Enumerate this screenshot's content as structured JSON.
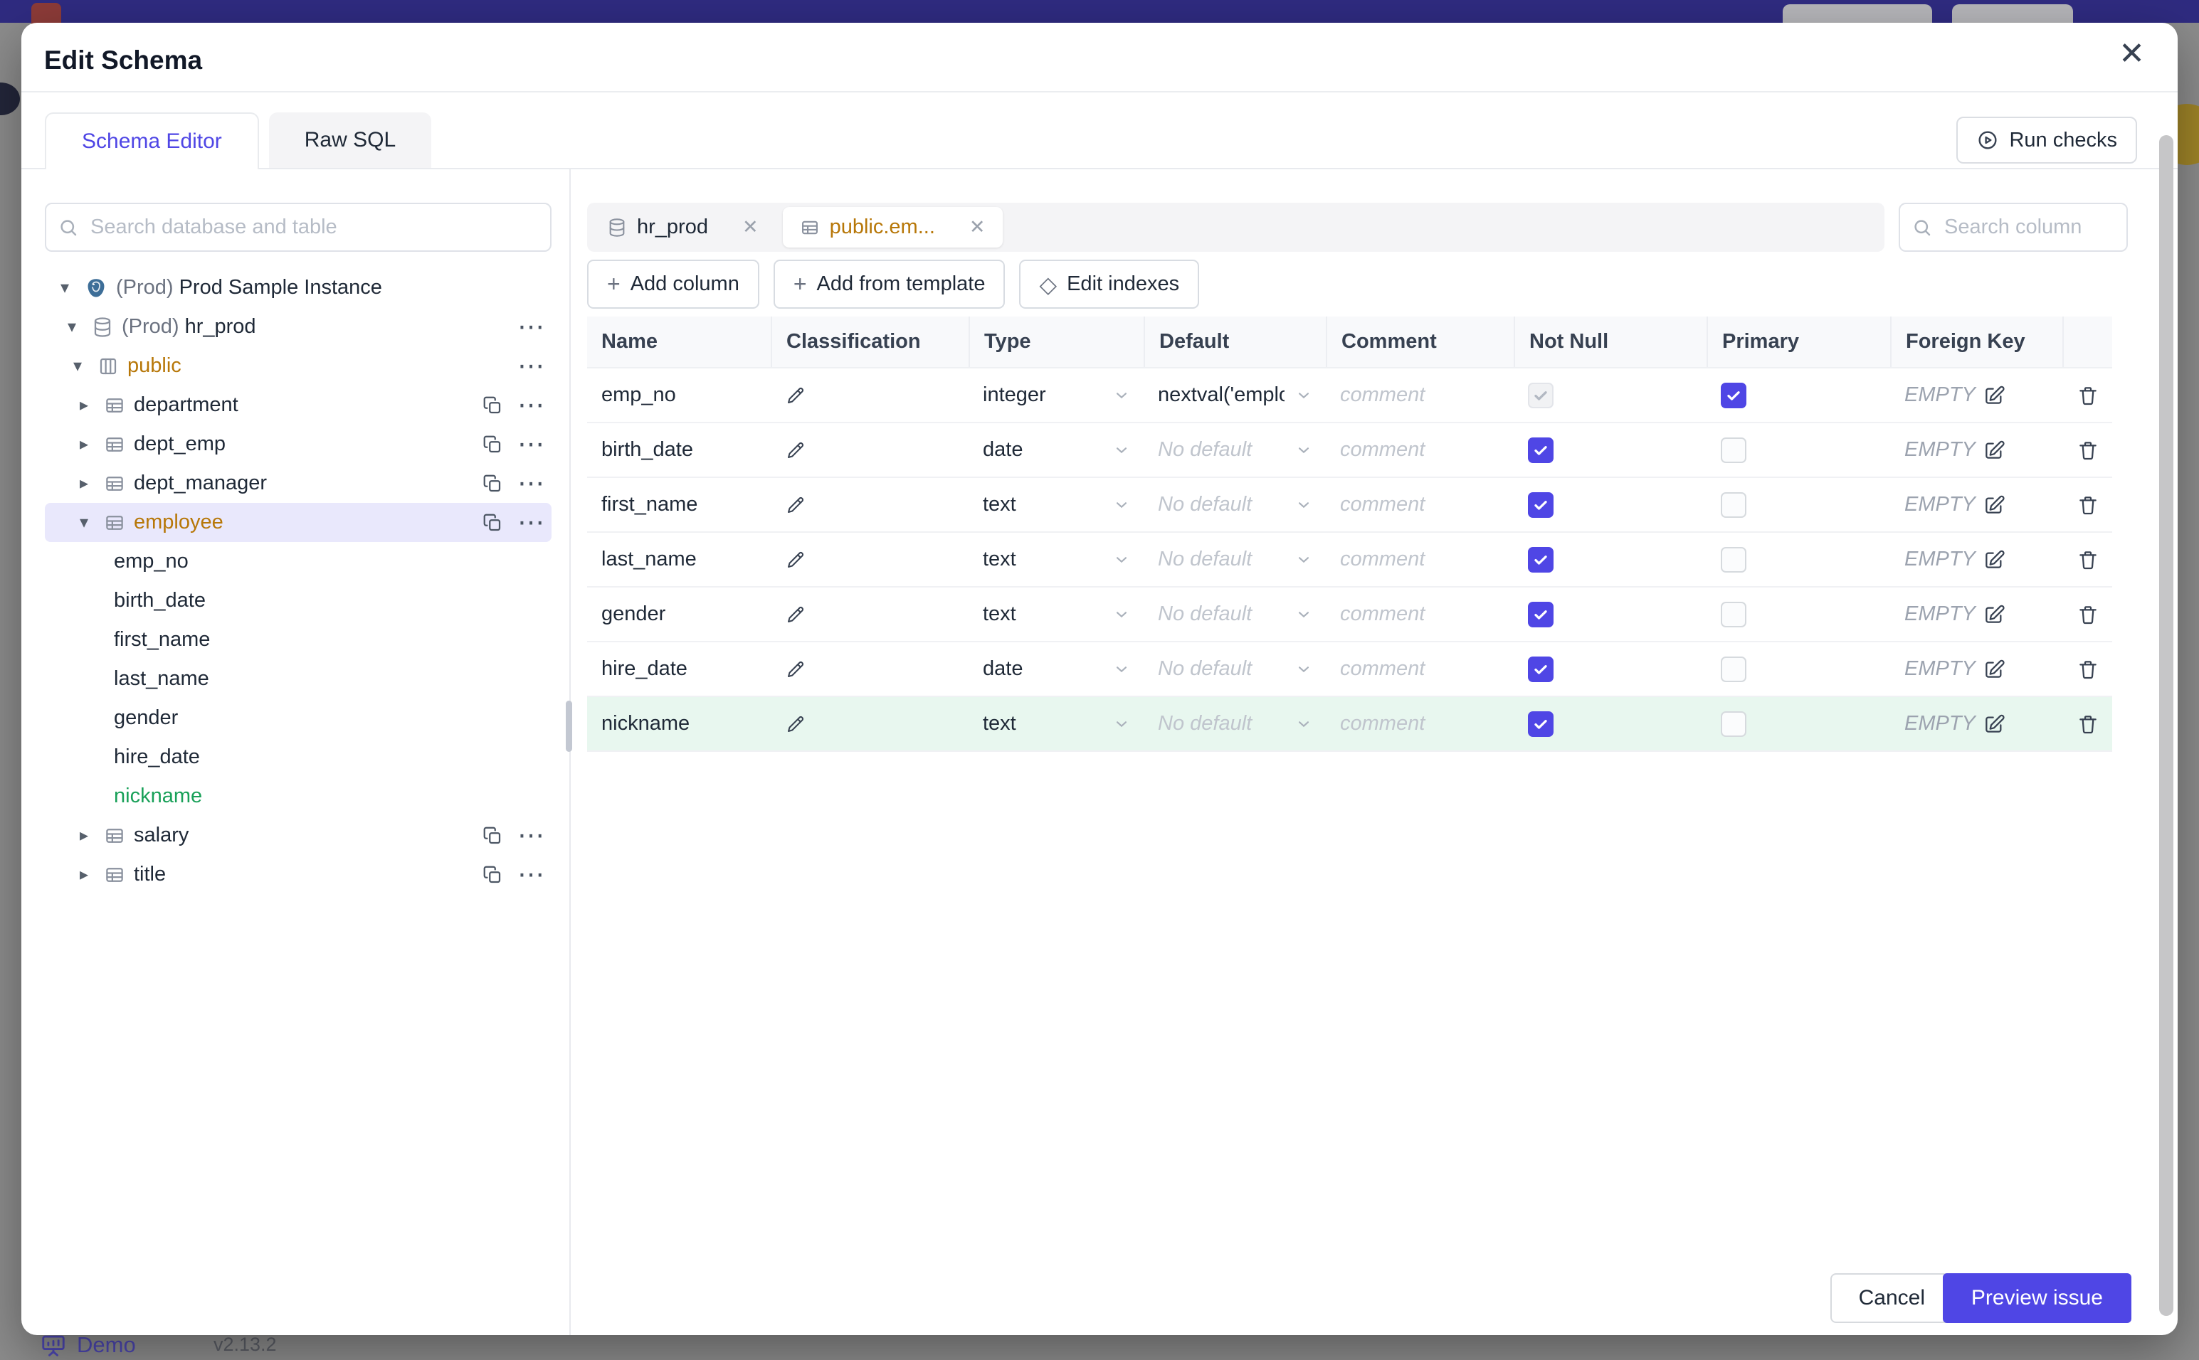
{
  "colors": {
    "accent": "#4f46e5",
    "amber": "#b77708",
    "green": "#18a058",
    "green_row_bg": "#e8f7ef",
    "selected_tree_bg": "#e9e8fc",
    "topbar": "#2f2b80"
  },
  "icons": {
    "close": "✕",
    "more": "⋯",
    "caret_down": "▾",
    "caret_right": "▸",
    "plus": "+",
    "diamond": "◇"
  },
  "background": {
    "footer": {
      "demo_label": "Demo",
      "version": "v2.13.2"
    }
  },
  "modal": {
    "title": "Edit Schema",
    "tabs": [
      {
        "label": "Schema Editor",
        "active": true
      },
      {
        "label": "Raw SQL",
        "active": false
      }
    ],
    "run_checks_label": "Run checks",
    "sidebar": {
      "search_placeholder": "Search database and table",
      "tree": [
        {
          "prefix": "(Prod)",
          "label": "Prod Sample Instance",
          "icon": "postgres-icon"
        },
        {
          "prefix": "(Prod)",
          "label": "hr_prod",
          "icon": "database-icon"
        },
        {
          "label": "public",
          "icon": "schema-icon"
        },
        {
          "label": "department",
          "icon": "table-icon"
        },
        {
          "label": "dept_emp",
          "icon": "table-icon"
        },
        {
          "label": "dept_manager",
          "icon": "table-icon"
        },
        {
          "label": "employee",
          "icon": "table-icon",
          "selected": true
        },
        {
          "label": "emp_no"
        },
        {
          "label": "birth_date"
        },
        {
          "label": "first_name"
        },
        {
          "label": "last_name"
        },
        {
          "label": "gender"
        },
        {
          "label": "hire_date"
        },
        {
          "label": "nickname",
          "state": "new"
        },
        {
          "label": "salary",
          "icon": "table-icon"
        },
        {
          "label": "title",
          "icon": "table-icon"
        }
      ]
    },
    "main": {
      "tabs": [
        {
          "label": "hr_prod",
          "icon": "database-icon",
          "active": false
        },
        {
          "label": "public.em...",
          "icon": "table-icon",
          "active": true
        }
      ],
      "column_search_placeholder": "Search column",
      "actions": {
        "add_column": "Add column",
        "add_from_template": "Add from template",
        "edit_indexes": "Edit indexes"
      },
      "table": {
        "headers": {
          "name": "Name",
          "classification": "Classification",
          "type": "Type",
          "default": "Default",
          "comment": "Comment",
          "not_null": "Not Null",
          "primary": "Primary",
          "foreign_key": "Foreign Key"
        },
        "comment_placeholder": "comment",
        "rows": [
          {
            "name": "emp_no",
            "type": "integer",
            "default": "nextval('employ",
            "default_is_value": true,
            "not_null": "checked-disabled",
            "primary": "checked",
            "foreign_key": "EMPTY"
          },
          {
            "name": "birth_date",
            "type": "date",
            "default": "No default",
            "default_is_value": false,
            "not_null": "checked",
            "primary": "unchecked",
            "foreign_key": "EMPTY"
          },
          {
            "name": "first_name",
            "type": "text",
            "default": "No default",
            "default_is_value": false,
            "not_null": "checked",
            "primary": "unchecked",
            "foreign_key": "EMPTY"
          },
          {
            "name": "last_name",
            "type": "text",
            "default": "No default",
            "default_is_value": false,
            "not_null": "checked",
            "primary": "unchecked",
            "foreign_key": "EMPTY"
          },
          {
            "name": "gender",
            "type": "text",
            "default": "No default",
            "default_is_value": false,
            "not_null": "checked",
            "primary": "unchecked",
            "foreign_key": "EMPTY"
          },
          {
            "name": "hire_date",
            "type": "date",
            "default": "No default",
            "default_is_value": false,
            "not_null": "checked",
            "primary": "unchecked",
            "foreign_key": "EMPTY"
          },
          {
            "name": "nickname",
            "type": "text",
            "default": "No default",
            "default_is_value": false,
            "not_null": "checked",
            "primary": "unchecked",
            "foreign_key": "EMPTY",
            "highlight": "new"
          }
        ]
      }
    },
    "footer": {
      "cancel": "Cancel",
      "primary": "Preview issue"
    }
  }
}
